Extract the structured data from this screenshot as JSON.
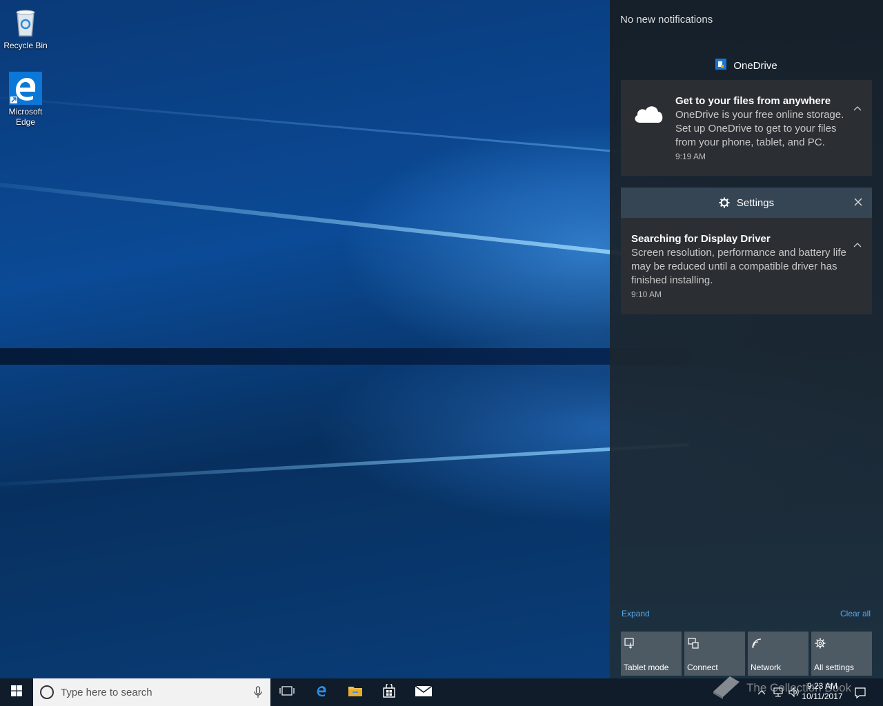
{
  "desktop": {
    "icons": [
      {
        "label": "Recycle Bin",
        "icon": "recycle-bin-icon"
      },
      {
        "label": "Microsoft Edge",
        "icon": "edge-icon"
      }
    ]
  },
  "action_center": {
    "status": "No new notifications",
    "groups": [
      {
        "app": "OneDrive",
        "icon": "onedrive-icon",
        "notifications": [
          {
            "title": "Get to your files from anywhere",
            "body": "OneDrive is your free online storage. Set up OneDrive to get to your files from your phone, tablet, and PC.",
            "time": "9:19 AM"
          }
        ]
      },
      {
        "app": "Settings",
        "icon": "gear-icon",
        "notifications": [
          {
            "title": "Searching for Display Driver",
            "body": "Screen resolution, performance and battery life may be reduced until a compatible driver has finished installing.",
            "time": "9:10 AM"
          }
        ]
      }
    ],
    "expand_label": "Expand",
    "clear_all_label": "Clear all",
    "quick_actions": [
      {
        "label": "Tablet mode",
        "icon": "tablet-mode-icon"
      },
      {
        "label": "Connect",
        "icon": "connect-icon"
      },
      {
        "label": "Network",
        "icon": "network-icon"
      },
      {
        "label": "All settings",
        "icon": "gear-icon"
      }
    ]
  },
  "taskbar": {
    "search_placeholder": "Type here to search",
    "pinned": [
      "task-view-icon",
      "edge-icon",
      "file-explorer-icon",
      "store-icon",
      "mail-icon"
    ],
    "clock": {
      "time": "9:23 AM",
      "date": "10/11/2017"
    }
  },
  "watermark": "The Collection Book",
  "colors": {
    "accent_link": "#58a8ec",
    "panel_bg": "#1c262f",
    "card_bg": "#2b2f33",
    "tile_bg": "#4d5963",
    "taskbar_bg": "#101c2a"
  }
}
